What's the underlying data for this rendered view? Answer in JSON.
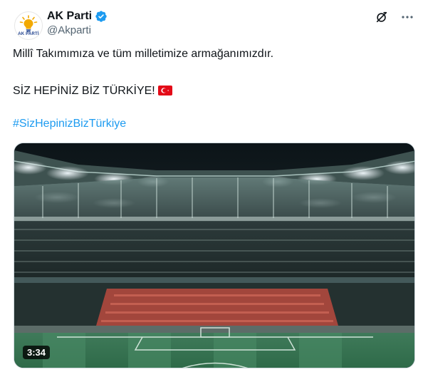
{
  "account": {
    "display_name": "AK Parti",
    "handle": "@Akparti",
    "avatar_text": "AK PARTİ"
  },
  "icons": {
    "verified": "verified-badge-icon",
    "grok": "grok-icon",
    "more": "more-options-icon",
    "flag": "turkey-flag-icon"
  },
  "tweet": {
    "line1": "Millî Takımımıza ve tüm milletimize armağanımızdır.",
    "line2": "SİZ HEPİNİZ BİZ TÜRKİYE!",
    "hashtag": "#SizHepinizBizTürkiye"
  },
  "media": {
    "kind": "video",
    "description": "stadium",
    "duration": "3:34"
  },
  "colors": {
    "link": "#1d9bf0",
    "verified": "#1d9bf0",
    "flag": "#e30a17"
  }
}
